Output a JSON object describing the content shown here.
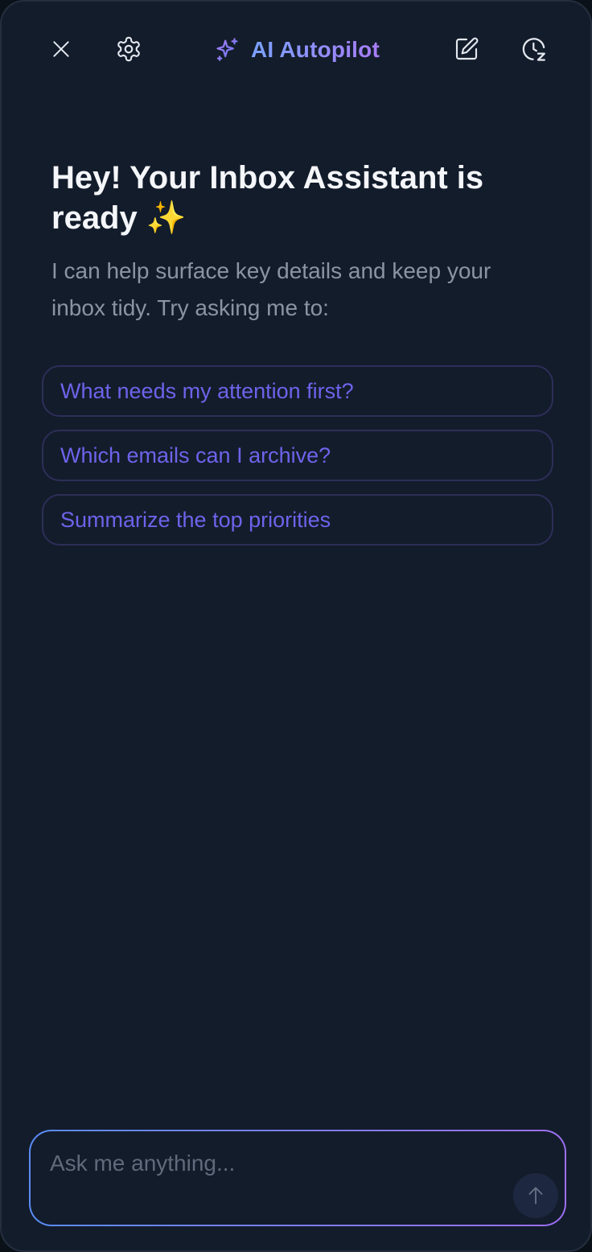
{
  "header": {
    "title": "AI Autopilot",
    "icons": {
      "close": "close-icon",
      "settings": "gear-icon",
      "brand": "sparkle-icon",
      "new_chat": "compose-icon",
      "history": "history-clock-icon"
    }
  },
  "welcome": {
    "headline": "Hey! Your Inbox Assistant is ready ✨",
    "subtext": "I can help surface key details and keep your inbox tidy. Try asking me to:"
  },
  "suggestions": [
    "What needs my attention first?",
    "Which emails can I archive?",
    "Summarize the top priorities"
  ],
  "composer": {
    "placeholder": "Ask me anything...",
    "value": "",
    "send_icon": "arrow-up-icon"
  },
  "colors": {
    "background": "#131c2b",
    "accent_blue": "#5a8cf5",
    "accent_purple": "#9d6ff2",
    "suggestion_text": "#6d63ea"
  }
}
